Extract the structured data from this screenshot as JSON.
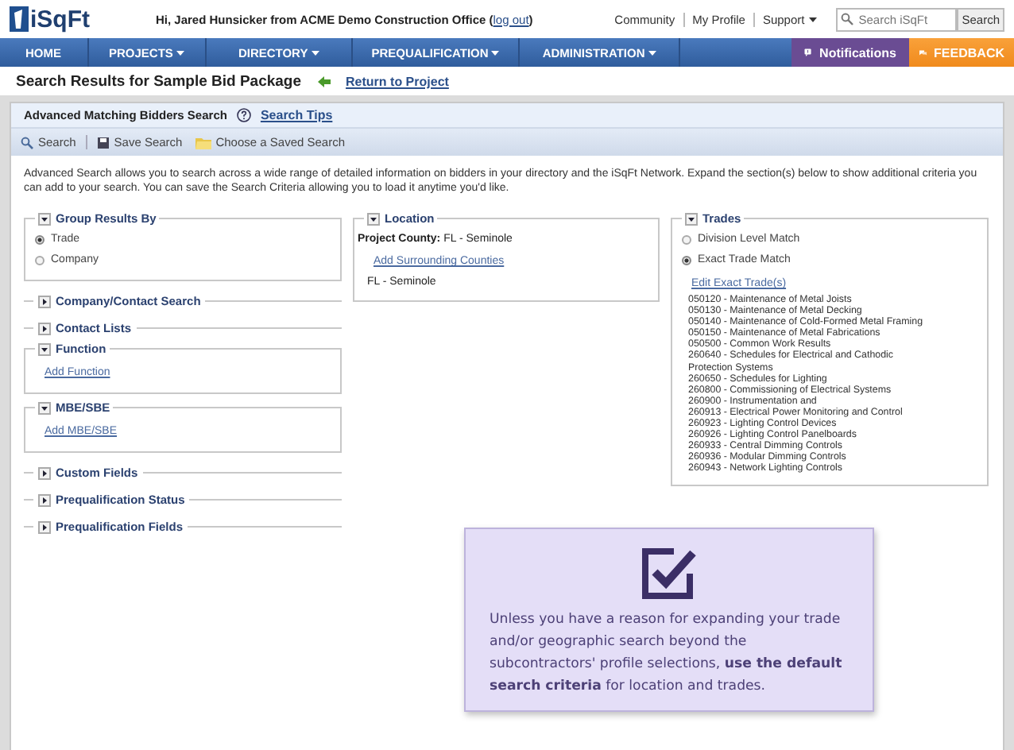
{
  "header": {
    "logo": "iSqFt",
    "greeting_before": "Hi, Jared Hunsicker from ACME Demo Construction Office (",
    "logout": "log out",
    "greeting_after": ")",
    "top_links": [
      {
        "label": "Community",
        "dropdown": false
      },
      {
        "label": "My Profile",
        "dropdown": false
      },
      {
        "label": "Support",
        "dropdown": true
      }
    ],
    "search": {
      "placeholder": "Search iSqFt",
      "button": "Search"
    }
  },
  "nav": {
    "items": [
      {
        "label": "HOME",
        "dropdown": false
      },
      {
        "label": "PROJECTS",
        "dropdown": true
      },
      {
        "label": "DIRECTORY",
        "dropdown": true
      },
      {
        "label": "PREQUALIFICATION",
        "dropdown": true
      },
      {
        "label": "ADMINISTRATION",
        "dropdown": true
      }
    ],
    "notifications": "Notifications",
    "feedback": "FEEDBACK"
  },
  "page_title": "Search Results for Sample Bid Package",
  "return_link": "Return to Project",
  "panel": {
    "title": "Advanced Matching Bidders Search",
    "tips": "Search Tips",
    "toolbar": [
      {
        "label": "Search"
      },
      {
        "label": "Save Search"
      },
      {
        "label": "Choose a Saved Search"
      }
    ],
    "description": "Advanced Search allows you to search across a wide range of detailed information on bidders in your directory and the iSqFt Network. Expand the section(s) below to show additional criteria you can add to your search. You can save the Search Criteria allowing you to load it anytime you'd like.",
    "columns": [
      [
        {
          "title": "Group Results By",
          "expanded": true,
          "items": [
            {
              "kind": "radio",
              "label": "Trade",
              "selected": true
            },
            {
              "kind": "radio",
              "label": "Company",
              "selected": false
            }
          ]
        },
        {
          "title": "Company/Contact Search",
          "expanded": false
        },
        {
          "title": "Contact Lists",
          "expanded": false
        },
        {
          "title": "Function",
          "expanded": true,
          "items": [
            {
              "kind": "link",
              "label": "Add Function"
            }
          ]
        },
        {
          "title": "MBE/SBE",
          "expanded": true,
          "items": [
            {
              "kind": "link",
              "label": "Add MBE/SBE"
            }
          ]
        },
        {
          "title": "Custom Fields",
          "expanded": false
        },
        {
          "title": "Prequalification Status",
          "expanded": false
        },
        {
          "title": "Prequalification Fields",
          "expanded": false
        }
      ],
      [
        {
          "title": "Location",
          "expanded": true,
          "items": [
            {
              "kind": "text",
              "label": "**Project County:** FL - Seminole"
            },
            {
              "kind": "link",
              "label": "Add Surrounding Counties"
            },
            {
              "kind": "text",
              "label": "FL - Seminole"
            }
          ]
        }
      ],
      [
        {
          "title": "Trades",
          "expanded": true,
          "items": [
            {
              "kind": "radio",
              "label": "Division Level Match",
              "selected": false
            },
            {
              "kind": "radio",
              "label": "Exact Trade Match",
              "selected": true
            },
            {
              "kind": "link",
              "label": "Edit Exact Trade(s)"
            },
            {
              "kind": "trade",
              "label": "050120 - Maintenance of Metal Joists"
            },
            {
              "kind": "trade",
              "label": "050130 - Maintenance of Metal Decking"
            },
            {
              "kind": "trade",
              "label": "050140 - Maintenance of Cold-Formed Metal Framing"
            },
            {
              "kind": "trade",
              "label": "050150 - Maintenance of Metal Fabrications"
            },
            {
              "kind": "trade",
              "label": "050500 - Common Work Results"
            },
            {
              "kind": "trade",
              "label": "260640 - Schedules for Electrical and Cathodic Protection Systems"
            },
            {
              "kind": "trade",
              "label": "260650 - Schedules for Lighting"
            },
            {
              "kind": "trade",
              "label": "260800 - Commissioning of Electrical Systems"
            },
            {
              "kind": "trade",
              "label": "260900 - Instrumentation and"
            },
            {
              "kind": "trade",
              "label": "260913 - Electrical Power Monitoring and Control"
            },
            {
              "kind": "trade",
              "label": "260923 - Lighting Control Devices"
            },
            {
              "kind": "trade",
              "label": "260926 - Lighting Control Panelboards"
            },
            {
              "kind": "trade",
              "label": "260933 - Central Dimming Controls"
            },
            {
              "kind": "trade",
              "label": "260936 - Modular Dimming Controls"
            },
            {
              "kind": "trade",
              "label": "260943 - Network Lighting Controls"
            }
          ]
        }
      ]
    ]
  },
  "callout": {
    "text": "Unless you have a reason for expanding your trade and/or geographic search beyond the subcontractors' profile selections, **use the default search criteria** for location and trades."
  }
}
